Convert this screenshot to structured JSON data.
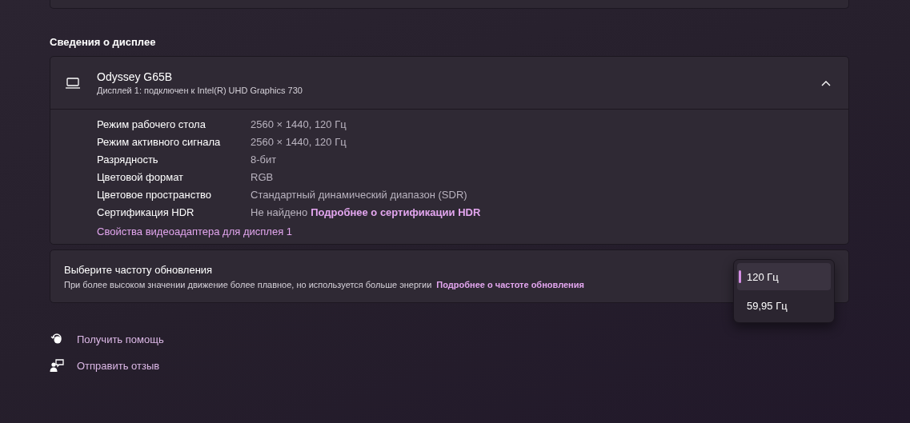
{
  "section_title": "Сведения о дисплее",
  "display": {
    "name": "Odyssey G65B",
    "subtitle": "Дисплей 1: подключен к Intel(R) UHD Graphics 730",
    "expanded": true,
    "properties": [
      {
        "label": "Режим рабочего стола",
        "value": "2560 × 1440, 120 Гц"
      },
      {
        "label": "Режим активного сигнала",
        "value": "2560 × 1440, 120 Гц"
      },
      {
        "label": "Разрядность",
        "value": "8-бит"
      },
      {
        "label": "Цветовой формат",
        "value": "RGB"
      },
      {
        "label": "Цветовое пространство",
        "value": "Стандартный динамический диапазон (SDR)"
      },
      {
        "label": "Сертификация HDR",
        "value": "Не найдено",
        "link": "Подробнее о сертификации HDR"
      }
    ],
    "adapter_link": "Свойства видеоадаптера для дисплея 1"
  },
  "refresh_rate": {
    "title": "Выберите частоту обновления",
    "description": "При более высоком значении движение более плавное, но используется больше энергии",
    "link": "Подробнее о частоте обновления",
    "options": [
      {
        "label": "120 Гц",
        "selected": true
      },
      {
        "label": "59,95 Гц",
        "selected": false
      }
    ]
  },
  "footer_links": [
    {
      "kind": "help",
      "label": "Получить помощь"
    },
    {
      "kind": "feedback",
      "label": "Отправить отзыв"
    }
  ]
}
